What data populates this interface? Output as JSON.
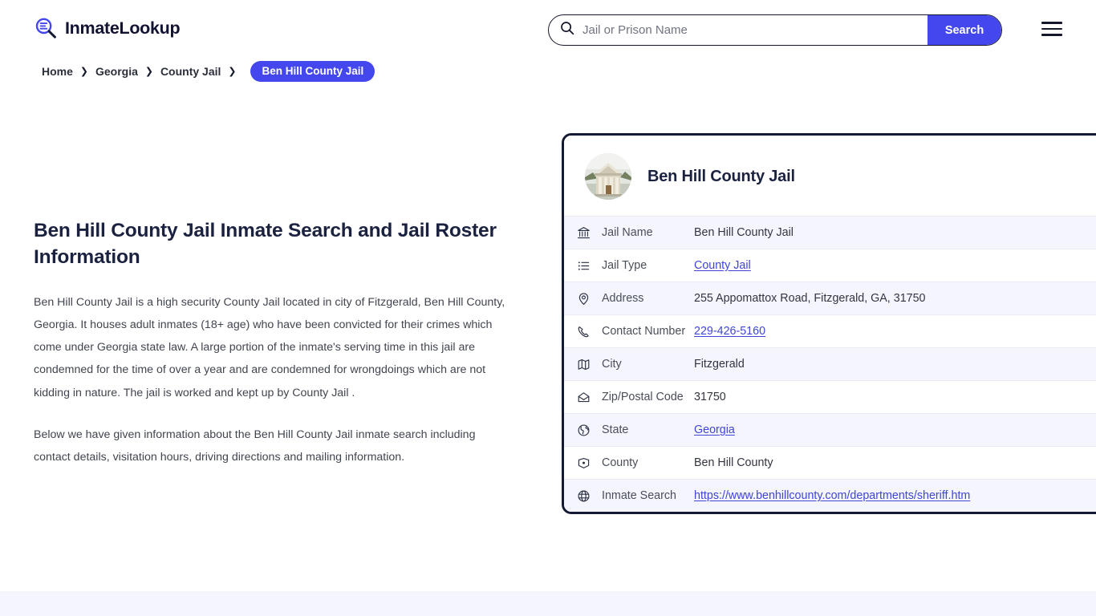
{
  "brand": {
    "name": "InmateLookup",
    "icon": "magnifier-list-icon"
  },
  "search": {
    "placeholder": "Jail or Prison Name",
    "value": "",
    "button_label": "Search",
    "icon": "search-icon"
  },
  "menu": {
    "icon": "hamburger-menu-icon"
  },
  "breadcrumb": {
    "items": [
      {
        "label": "Home"
      },
      {
        "label": "Georgia"
      },
      {
        "label": "County Jail"
      }
    ],
    "separator": "❯",
    "current": "Ben Hill County Jail"
  },
  "main": {
    "title": "Ben Hill County Jail Inmate Search and Jail Roster Information",
    "paragraphs": [
      "Ben Hill County Jail is a high security County Jail located in city of Fitzgerald, Ben Hill County, Georgia. It houses adult inmates (18+ age) who have been convicted for their crimes which come under Georgia state law. A large portion of the inmate's serving time in this jail are condemned for the time of over a year and are condemned for wrongdoings which are not kidding in nature. The jail is worked and kept up by County Jail .",
      "Below we have given information about the Ben Hill County Jail inmate search including contact details, visitation hours, driving directions and mailing information."
    ]
  },
  "card": {
    "title": "Ben Hill County Jail",
    "avatar_icon": "courthouse-photo",
    "rows": [
      {
        "icon": "bank-icon",
        "label": "Jail Name",
        "value": "Ben Hill County Jail",
        "link": false
      },
      {
        "icon": "list-icon",
        "label": "Jail Type",
        "value": "County Jail",
        "link": true
      },
      {
        "icon": "map-pin-icon",
        "label": "Address",
        "value": "255 Appomattox Road, Fitzgerald, GA, 31750",
        "link": false
      },
      {
        "icon": "phone-icon",
        "label": "Contact Number",
        "value": "229-426-5160",
        "link": true
      },
      {
        "icon": "map-icon",
        "label": "City",
        "value": "Fitzgerald",
        "link": false
      },
      {
        "icon": "envelope-icon",
        "label": "Zip/Postal Code",
        "value": "31750",
        "link": false
      },
      {
        "icon": "globe-americas-icon",
        "label": "State",
        "value": "Georgia",
        "link": true
      },
      {
        "icon": "map-marker-icon",
        "label": "County",
        "value": "Ben Hill County",
        "link": false
      },
      {
        "icon": "globe-icon",
        "label": "Inmate Search",
        "value": "https://www.benhillcounty.com/departments/sheriff.htm",
        "link": true
      }
    ]
  },
  "colors": {
    "accent": "#4447ee",
    "card_border": "#141a33",
    "row_alt_bg": "#f5f6fd",
    "link": "#3f45d8",
    "heading": "#1b2240"
  }
}
